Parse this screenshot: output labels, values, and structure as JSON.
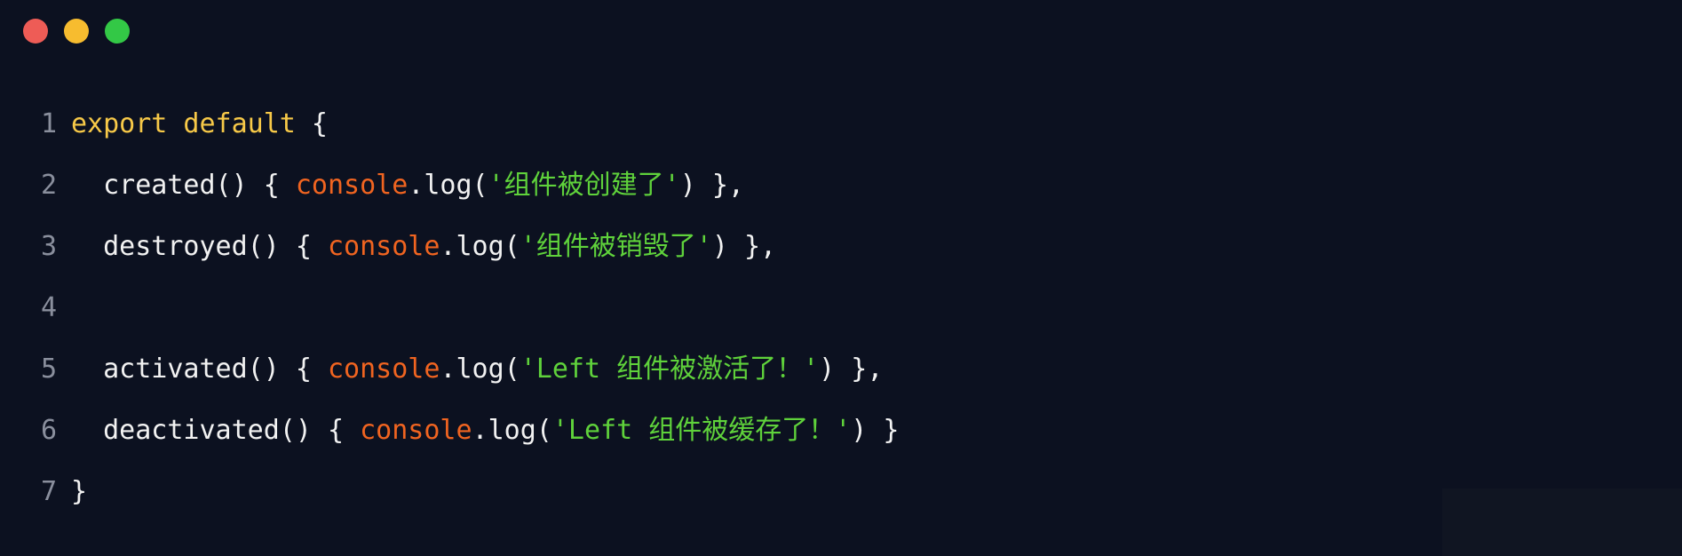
{
  "window": {
    "traffic_lights": [
      {
        "name": "close",
        "color": "#ee5c56"
      },
      {
        "name": "minimize",
        "color": "#f7bc2f"
      },
      {
        "name": "maximize",
        "color": "#33c846"
      }
    ]
  },
  "code": {
    "lines": [
      {
        "n": "1",
        "segments": [
          {
            "t": "export default",
            "c": "kw"
          },
          {
            "t": " {",
            "c": "txt"
          }
        ]
      },
      {
        "n": "2",
        "segments": [
          {
            "t": "  created() { ",
            "c": "txt"
          },
          {
            "t": "console",
            "c": "cons"
          },
          {
            "t": ".log(",
            "c": "txt"
          },
          {
            "t": "'组件被创建了'",
            "c": "str"
          },
          {
            "t": ") },",
            "c": "txt"
          }
        ]
      },
      {
        "n": "3",
        "segments": [
          {
            "t": "  destroyed() { ",
            "c": "txt"
          },
          {
            "t": "console",
            "c": "cons"
          },
          {
            "t": ".log(",
            "c": "txt"
          },
          {
            "t": "'组件被销毁了'",
            "c": "str"
          },
          {
            "t": ") },",
            "c": "txt"
          }
        ]
      },
      {
        "n": "4",
        "segments": []
      },
      {
        "n": "5",
        "segments": [
          {
            "t": "  activated() { ",
            "c": "txt"
          },
          {
            "t": "console",
            "c": "cons"
          },
          {
            "t": ".log(",
            "c": "txt"
          },
          {
            "t": "'Left 组件被激活了！'",
            "c": "str"
          },
          {
            "t": ") },",
            "c": "txt"
          }
        ]
      },
      {
        "n": "6",
        "segments": [
          {
            "t": "  deactivated() { ",
            "c": "txt"
          },
          {
            "t": "console",
            "c": "cons"
          },
          {
            "t": ".log(",
            "c": "txt"
          },
          {
            "t": "'Left 组件被缓存了！'",
            "c": "str"
          },
          {
            "t": ") }",
            "c": "txt"
          }
        ]
      },
      {
        "n": "7",
        "segments": [
          {
            "t": "}",
            "c": "txt"
          }
        ]
      }
    ]
  }
}
